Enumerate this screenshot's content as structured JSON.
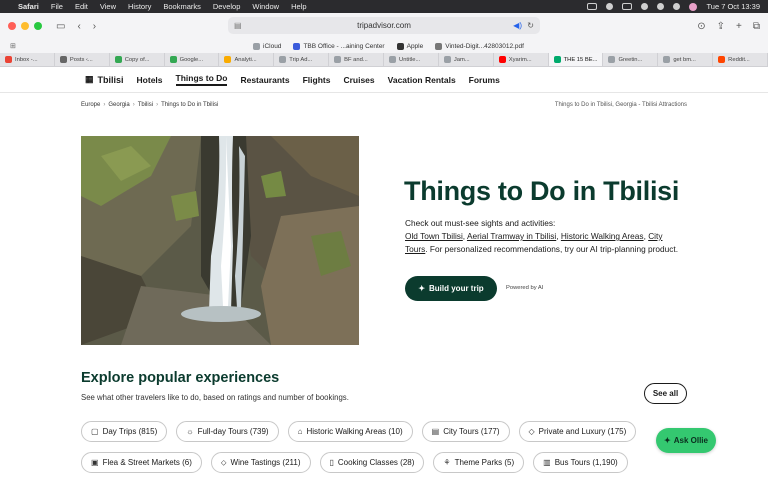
{
  "menubar": {
    "apple_icon": "apple-logo-icon",
    "items": [
      "Safari",
      "File",
      "Edit",
      "View",
      "History",
      "Bookmarks",
      "Develop",
      "Window",
      "Help"
    ],
    "clock": "Tue 7 Oct  13:39"
  },
  "toolbar": {
    "url": "tripadvisor.com"
  },
  "favorites": [
    {
      "label": "iCloud",
      "color": "#9aa0a6"
    },
    {
      "label": "TBB Office - ...aining Center",
      "color": "#3b5bdb"
    },
    {
      "label": "Apple",
      "color": "#333333"
    },
    {
      "label": "Vinted-Digit...42803012.pdf",
      "color": "#777777"
    }
  ],
  "tabs": [
    {
      "label": "Inbox -...",
      "color": "#ea4335"
    },
    {
      "label": "Posts ‹...",
      "color": "#666666"
    },
    {
      "label": "Copy of...",
      "color": "#34a853"
    },
    {
      "label": "Google...",
      "color": "#34a853"
    },
    {
      "label": "Analyti...",
      "color": "#f9ab00"
    },
    {
      "label": "Trip Ad...",
      "color": "#9aa0a6"
    },
    {
      "label": "BF and...",
      "color": "#9aa0a6"
    },
    {
      "label": "Untitle...",
      "color": "#9aa0a6"
    },
    {
      "label": "Jam...",
      "color": "#9aa0a6"
    },
    {
      "label": "Xyarim...",
      "color": "#ff0000"
    },
    {
      "label": "THE 15 BE...",
      "color": "#00aa6c",
      "active": true
    },
    {
      "label": "Greetin...",
      "color": "#9aa0a6"
    },
    {
      "label": "get bm...",
      "color": "#9aa0a6"
    },
    {
      "label": "Reddit...",
      "color": "#ff4500"
    }
  ],
  "site_nav": {
    "city": "Tbilisi",
    "links": [
      "Hotels",
      "Things to Do",
      "Restaurants",
      "Flights",
      "Cruises",
      "Vacation Rentals",
      "Forums"
    ]
  },
  "breadcrumb": [
    "Europe",
    "Georgia",
    "Tbilisi",
    "Things to Do in Tbilisi"
  ],
  "breadcrumb_title": "Things to Do in Tbilisi, Georgia - Tbilisi Attractions",
  "hero": {
    "title": "Things to Do in Tbilisi",
    "desc_intro": "Check out must-see sights and activities:",
    "links": [
      "Old Town Tbilisi",
      "Aerial Tramway in Tbilisi",
      "Historic Walking Areas",
      "City Tours"
    ],
    "desc_outro": ". For personalized recommendations, try our AI trip-planning product.",
    "build_button": "Build your trip",
    "powered_by": "Powered by AI"
  },
  "explore": {
    "title": "Explore popular experiences",
    "subtitle": "See what other travelers like to do, based on ratings and number of bookings.",
    "see_all": "See all",
    "chips_row1": [
      {
        "label": "Day Trips (815)",
        "icon": "day-trips-icon",
        "glyph": "▢"
      },
      {
        "label": "Full-day Tours (739)",
        "icon": "sun-icon",
        "glyph": "☼"
      },
      {
        "label": "Historic Walking Areas (10)",
        "icon": "landmark-icon",
        "glyph": "⌂"
      },
      {
        "label": "City Tours (177)",
        "icon": "city-icon",
        "glyph": "▤"
      },
      {
        "label": "Private and Luxury (175)",
        "icon": "diamond-icon",
        "glyph": "◇"
      }
    ],
    "chips_row2": [
      {
        "label": "Flea & Street Markets (6)",
        "icon": "market-icon",
        "glyph": "▣"
      },
      {
        "label": "Wine Tastings (211)",
        "icon": "wine-glass-icon",
        "glyph": "⬦"
      },
      {
        "label": "Cooking Classes (28)",
        "icon": "bookmark-icon",
        "glyph": "▯"
      },
      {
        "label": "Theme Parks (5)",
        "icon": "theme-park-icon",
        "glyph": "⚘"
      },
      {
        "label": "Bus Tours (1,190)",
        "icon": "bus-icon",
        "glyph": "▥"
      }
    ]
  },
  "ask_ollie": "Ask Ollie",
  "colors": {
    "brand_dark": "#0b3b2e",
    "ollie_green": "#34c870"
  }
}
